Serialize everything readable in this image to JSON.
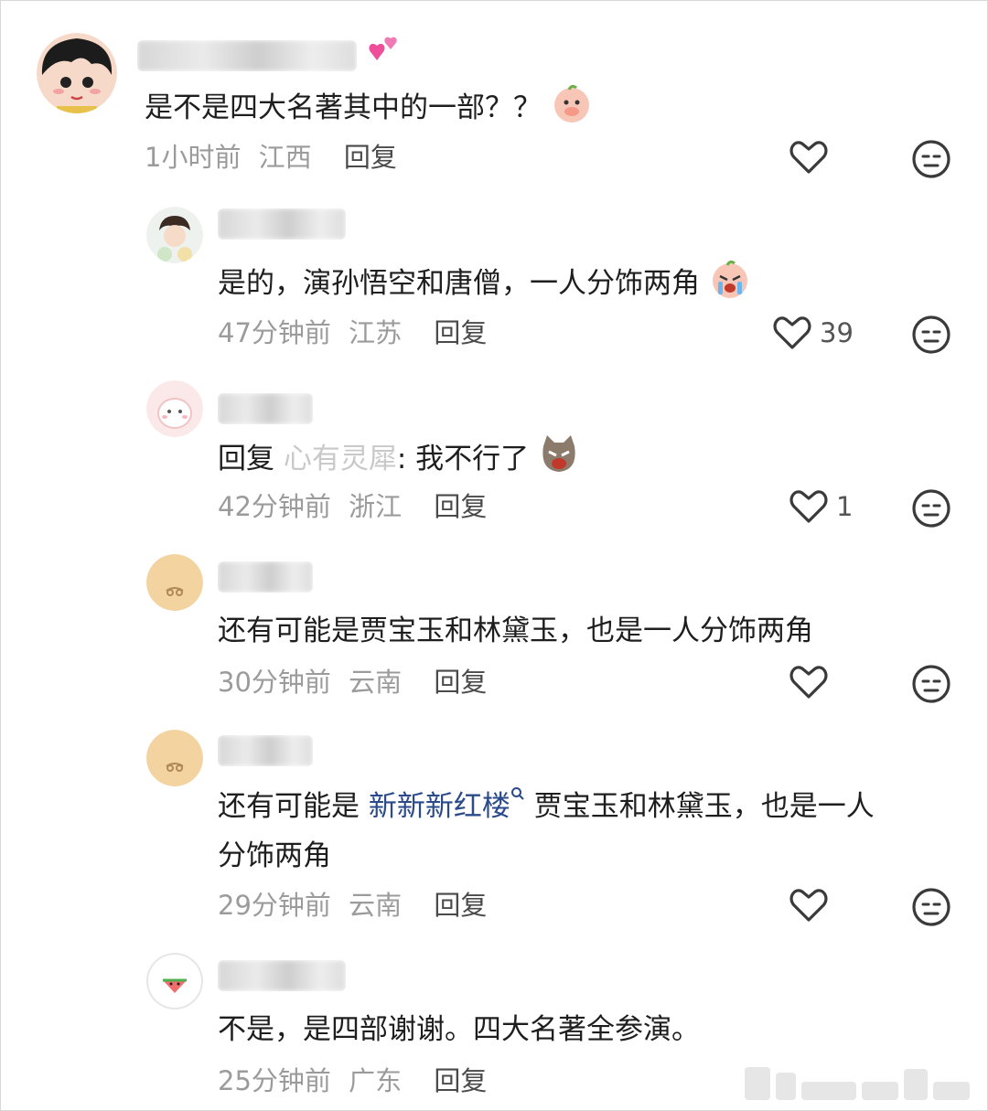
{
  "comments": [
    {
      "id": "c1",
      "text": "是不是四大名著其中的一部？？",
      "time": "1小时前",
      "location": "江西",
      "reply_label": "回复",
      "likes": ""
    },
    {
      "id": "c2",
      "text": "是的，演孙悟空和唐僧，一人分饰两角",
      "time": "47分钟前",
      "location": "江苏",
      "reply_label": "回复",
      "likes": "39"
    },
    {
      "id": "c3",
      "prefix": "回复",
      "mention": "心有灵犀",
      "text_after": ": 我不行了",
      "time": "42分钟前",
      "location": "浙江",
      "reply_label": "回复",
      "likes": "1"
    },
    {
      "id": "c4",
      "text": "还有可能是贾宝玉和林黛玉，也是一人分饰两角",
      "time": "30分钟前",
      "location": "云南",
      "reply_label": "回复",
      "likes": ""
    },
    {
      "id": "c5",
      "text_before": "还有可能是 ",
      "link": "新新新红楼",
      "text_line1_after": " 贾宝玉和林黛玉，也是一人",
      "text_line2": "分饰两角",
      "time": "29分钟前",
      "location": "云南",
      "reply_label": "回复",
      "likes": ""
    },
    {
      "id": "c6",
      "text": "不是，是四部谢谢。四大名著全参演。",
      "time": "25分钟前",
      "location": "广东",
      "reply_label": "回复",
      "likes": ""
    }
  ],
  "colors": {
    "text": "#1e1e1e",
    "meta": "#9b9b9b",
    "link": "#2b4a8a",
    "icon": "#3a3a3a"
  },
  "icons": {
    "like": "heart-outline-icon",
    "dislike": "neutral-face-icon",
    "search": "search-icon"
  }
}
